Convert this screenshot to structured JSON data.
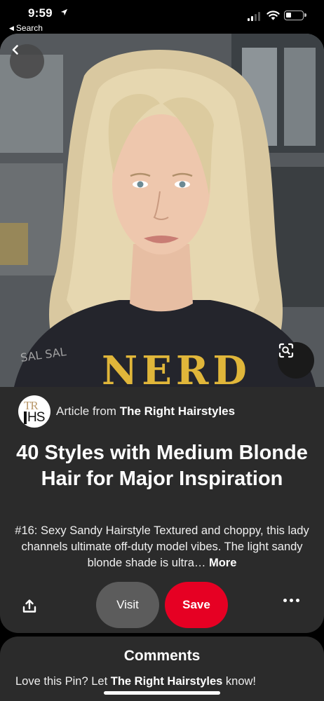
{
  "status_bar": {
    "time": "9:59",
    "back_app_label": "Search"
  },
  "pin": {
    "image_text": {
      "shirt": "NERD",
      "watermark": "SAL SAL"
    },
    "source": {
      "logo_top": "TR",
      "logo_bottom": "HS",
      "prefix": "Article from",
      "name": "The Right Hairstyles"
    },
    "title": "40 Styles with Medium Blonde Hair for Major Inspiration",
    "description": "#16: Sexy Sandy Hairstyle Textured and choppy, this lady channels ultimate off-duty model vibes. The light sandy blonde shade is ultra…",
    "more_label": "More"
  },
  "actions": {
    "visit_label": "Visit",
    "save_label": "Save"
  },
  "comments": {
    "title": "Comments",
    "prompt_prefix": "Love this Pin? Let",
    "prompt_name": "The Right Hairstyles",
    "prompt_suffix": "know!"
  },
  "colors": {
    "save_red": "#e60023",
    "card_bg": "#2b2b2b",
    "visit_gray": "#5c5c5c"
  },
  "icons": [
    "location-arrow-icon",
    "back-triangle-icon",
    "signal-icon",
    "wifi-icon",
    "battery-icon",
    "chevron-left-icon",
    "visual-search-icon",
    "share-icon",
    "more-dots-icon"
  ]
}
